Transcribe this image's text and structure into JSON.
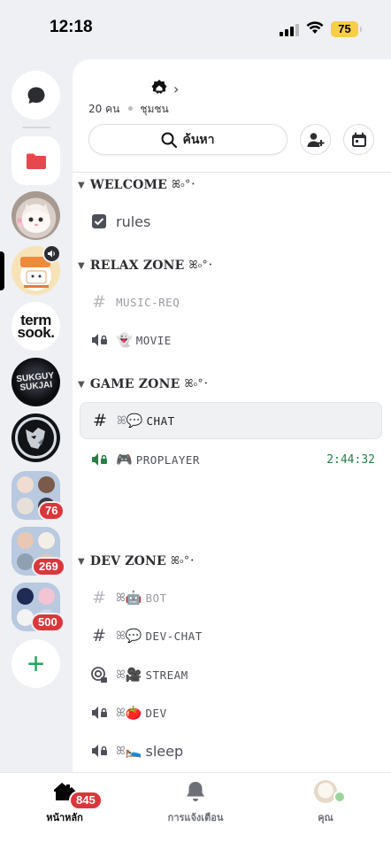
{
  "status_bar": {
    "time": "12:18",
    "battery": "75"
  },
  "server_rail": {
    "items": [
      {
        "name": "direct-messages",
        "icon": "chat-bubble-icon"
      },
      {
        "name": "folder",
        "icon": "folder-icon",
        "color": "#e5484d"
      },
      {
        "name": "server-cat"
      },
      {
        "name": "server-lak-label"
      },
      {
        "name": "server-term-sook",
        "text": "term\nsook."
      },
      {
        "name": "server-sukguy-sukjai",
        "text": "SUKGUY SUKJAI"
      },
      {
        "name": "server-wolf"
      }
    ],
    "folder_badges": [
      "76",
      "269",
      "500"
    ],
    "add_server_label": "+"
  },
  "guild": {
    "member_count": "20 คน",
    "community_label": "ชุมชน",
    "search_label": "ค้นหา"
  },
  "categories": [
    {
      "name": "WELCOME",
      "deco": "ꕤ৹°･"
    },
    {
      "name": "RELAX ZONE",
      "deco": "ꕤ৹°･"
    },
    {
      "name": "GAME ZONE",
      "deco": "ꕤ৹°･"
    },
    {
      "name": "DEV ZONE",
      "deco": "ꕤ৹°･"
    }
  ],
  "channels": {
    "rules": {
      "name": "rules"
    },
    "music_req": {
      "name": "MUSIC-REQ"
    },
    "movie": {
      "emoji": "👻",
      "name": "MOVIE"
    },
    "chat": {
      "emoji": "💬",
      "name": "CHAT"
    },
    "proplayer": {
      "emoji": "🎮",
      "name": "PROPLAYER",
      "timer": "2:44:32"
    },
    "bot": {
      "emoji": "🤖",
      "name": "BOT"
    },
    "dev_chat": {
      "emoji": "💬",
      "name": "DEV-CHAT"
    },
    "stream": {
      "emoji": "🎥",
      "name": "STREAM"
    },
    "dev": {
      "emoji": "🍅",
      "name": "DEV"
    },
    "sleep": {
      "emoji": "🛌",
      "name": "sleep"
    }
  },
  "tabbar": {
    "home_label": "หน้าหลัก",
    "home_badge": "845",
    "notifications_label": "การแจ้งเตือน",
    "you_label": "คุณ"
  },
  "colors": {
    "accent_green": "#23a55a",
    "badge_red": "#da373c",
    "voice_green": "#248046"
  }
}
